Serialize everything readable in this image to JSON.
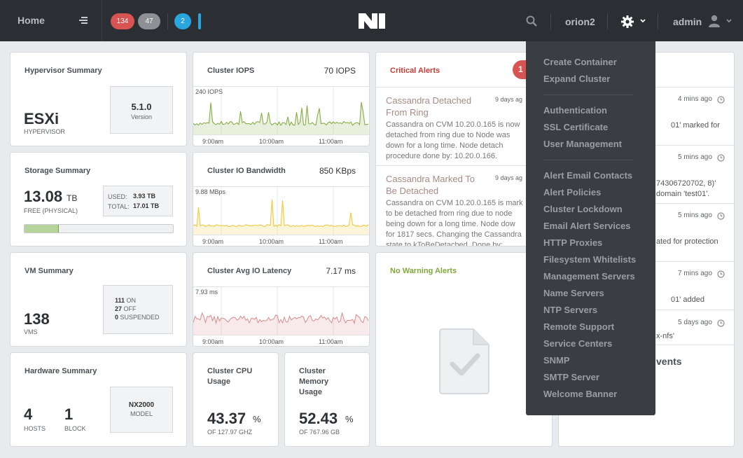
{
  "topbar": {
    "home_label": "Home",
    "badge_critical": "134",
    "badge_warning": "47",
    "badge_info": "2",
    "cluster_name": "orion2",
    "user_name": "admin",
    "icons": [
      "menu-icon",
      "logo-icon",
      "search-icon",
      "gear-icon",
      "chevron-down-icon",
      "user-icon"
    ]
  },
  "hypervisor": {
    "title": "Hypervisor Summary",
    "name": "ESXi",
    "name_label": "HYPERVISOR",
    "version": "5.1.0",
    "version_label": "Version"
  },
  "storage": {
    "title": "Storage Summary",
    "free_value": "13.08",
    "free_unit": "TB",
    "free_label": "FREE (PHYSICAL)",
    "used_label": "USED:",
    "used_value": "3.93 TB",
    "total_label": "TOTAL:",
    "total_value": "17.01 TB",
    "used_fraction": 0.231
  },
  "vm": {
    "title": "VM Summary",
    "count": "138",
    "count_label": "VMS",
    "on_count": "111",
    "on_label": "ON",
    "off_count": "27",
    "off_label": "OFF",
    "suspended_count": "0",
    "suspended_label": "SUSPENDED"
  },
  "hardware": {
    "title": "Hardware Summary",
    "hosts": "4",
    "hosts_label": "HOSTS",
    "blocks": "1",
    "blocks_label": "BLOCK",
    "model": "NX2000",
    "model_label": "MODEL"
  },
  "iops": {
    "title": "Cluster IOPS",
    "current": "70 IOPS",
    "max_label": "240 IOPS",
    "ticks": [
      "9:00am",
      "10:00am",
      "11:00am"
    ],
    "color": "#7fa83b"
  },
  "bandwidth": {
    "title": "Cluster IO Bandwidth",
    "current": "850 KBps",
    "max_label": "9.88 MBps",
    "ticks": [
      "9:00am",
      "10:00am",
      "11:00am"
    ],
    "color": "#f2c531"
  },
  "latency": {
    "title": "Cluster Avg IO Latency",
    "current": "7.17 ms",
    "max_label": "7.93 ms",
    "ticks": [
      "9:00am",
      "10:00am",
      "11:00am"
    ],
    "color": "#d98c8c"
  },
  "cpu": {
    "title_line1": "Cluster CPU",
    "title_line2": "Usage",
    "value": "43.37",
    "unit": "%",
    "of_label": "OF 127.97 GHz"
  },
  "memory": {
    "title_line1": "Cluster",
    "title_line2": "Memory",
    "title_line3": "Usage",
    "value": "52.43",
    "unit": "%",
    "of_label": "OF 767.96 GB"
  },
  "critical_alerts": {
    "title": "Critical Alerts",
    "count": "1",
    "items": [
      {
        "head_line1": "Cassandra Detached",
        "head_line2": "From Ring",
        "time": "9 days ag",
        "body": [
          "Cassandra on CVM 10.20.0.165 is now",
          "detached from ring due to Node was",
          "down for a long time. Node detach",
          "procedure done by: 10.20.0.166."
        ]
      },
      {
        "head_line1": "Cassandra Marked To",
        "head_line2": "Be Detached",
        "time": "9 days ag",
        "body": [
          "Cassandra on CVM 10.20.0.165 is mark",
          "to be detached from ring due to node",
          "being down for a long time. Node dow",
          "for 1817 secs. Changing the Cassandra",
          "state to kToBeDetached. Done by:"
        ]
      }
    ]
  },
  "warning_alerts": {
    "title": "No Warning Alerts"
  },
  "events": {
    "items": [
      {
        "time": "4 mins ago",
        "text": "01' marked for"
      },
      {
        "time": "5 mins ago",
        "text_line1": "74306720702, 8)'",
        "text_line2": "domain 'test01'."
      },
      {
        "time": "5 mins ago",
        "text": "ated for protection"
      },
      {
        "time": "7 mins ago",
        "text": "01' added"
      },
      {
        "time": "5 days ago",
        "text": "x-nfs'"
      }
    ],
    "footer": "vents"
  },
  "settings_menu": {
    "group1": [
      "Create Container",
      "Expand Cluster"
    ],
    "group2": [
      "Authentication",
      "SSL Certificate",
      "User Management"
    ],
    "group3": [
      "Alert Email Contacts",
      "Alert Policies",
      "Cluster Lockdown",
      "Email Alert Services",
      "HTTP Proxies",
      "Filesystem Whitelists",
      "Management Servers",
      "Name Servers",
      "NTP Servers",
      "Remote Support",
      "Service Centers",
      "SNMP",
      "SMTP Server",
      "Welcome Banner"
    ]
  }
}
